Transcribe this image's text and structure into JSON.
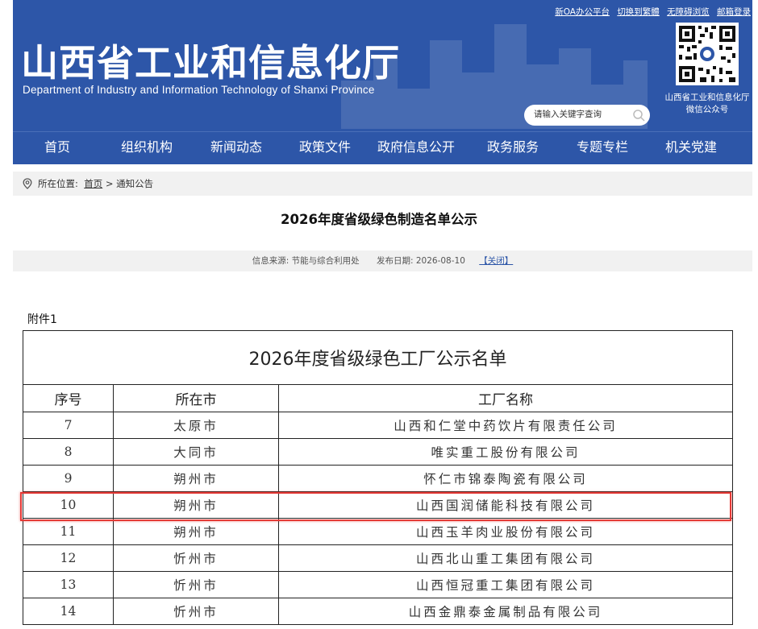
{
  "header": {
    "title": "山西省工业和信息化厅",
    "subtitle": "Department of Industry and Information Technology of Shanxi Province",
    "top_links": [
      "新OA办公平台",
      "切换到繁體",
      "无障碍浏览",
      "邮箱登录"
    ],
    "qr_caption_line1": "山西省工业和信息化厅",
    "qr_caption_line2": "微信公众号",
    "search_placeholder": "请输入关键字查询"
  },
  "nav": [
    "首页",
    "组织机构",
    "新闻动态",
    "政策文件",
    "政府信息公开",
    "政务服务",
    "专题专栏",
    "机关党建"
  ],
  "breadcrumb": {
    "label": "所在位置:",
    "home": "首页",
    "separator": ">",
    "current": "通知公告"
  },
  "article": {
    "title": "2026年度省级绿色制造名单公示",
    "source": "信息来源: 节能与综合利用处",
    "date": "发布日期: 2026-08-10",
    "close": "【关闭】"
  },
  "attachment_label": "附件1",
  "table": {
    "caption": "2026年度省级绿色工厂公示名单",
    "headers": [
      "序号",
      "所在市",
      "工厂名称"
    ],
    "rows": [
      {
        "no": "7",
        "city": "太原市",
        "name": "山西和仁堂中药饮片有限责任公司"
      },
      {
        "no": "8",
        "city": "大同市",
        "name": "唯实重工股份有限公司"
      },
      {
        "no": "9",
        "city": "朔州市",
        "name": "怀仁市锦泰陶瓷有限公司"
      },
      {
        "no": "10",
        "city": "朔州市",
        "name": "山西国润储能科技有限公司"
      },
      {
        "no": "11",
        "city": "朔州市",
        "name": "山西玉羊肉业股份有限公司"
      },
      {
        "no": "12",
        "city": "忻州市",
        "name": "山西北山重工集团有限公司"
      },
      {
        "no": "13",
        "city": "忻州市",
        "name": "山西恒冠重工集团有限公司"
      },
      {
        "no": "14",
        "city": "忻州市",
        "name": "山西金鼎泰金属制品有限公司"
      }
    ],
    "highlighted_row_no": "10",
    "highlight_color": "#e53935"
  },
  "colors": {
    "brand_blue": "#2d56a8",
    "panel_gray": "#f1f1f1"
  }
}
